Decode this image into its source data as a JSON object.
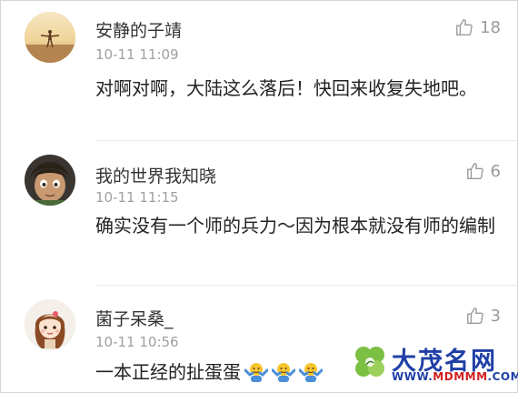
{
  "comments": [
    {
      "username": "安静的子靖",
      "time": "10-11 11:09",
      "text": "对啊对啊，大陆这么落后！快回来收复失地吧。",
      "likes": "18"
    },
    {
      "username": "我的世界我知晓",
      "time": "10-11 11:15",
      "text": "确实没有一个师的兵力～因为根本就没有师的编制",
      "likes": "6"
    },
    {
      "username": "菌子呆桑_",
      "time": "10-11 10:56",
      "text": "一本正经的扯蛋蛋",
      "likes": "3",
      "emojis": [
        "shrug-emoji",
        "shrug-emoji",
        "shrug-emoji"
      ]
    }
  ],
  "watermark": {
    "title": "大茂名网",
    "url_prefix": "WWW.",
    "url_brand": "MDMMM",
    "url_suffix": ".COM"
  },
  "colors": {
    "text": "#222222",
    "username": "#333333",
    "meta": "#a0a0a0",
    "watermark_blue": "#1f3fa6",
    "watermark_green": "#7bc043",
    "watermark_red": "#d21f1f"
  }
}
